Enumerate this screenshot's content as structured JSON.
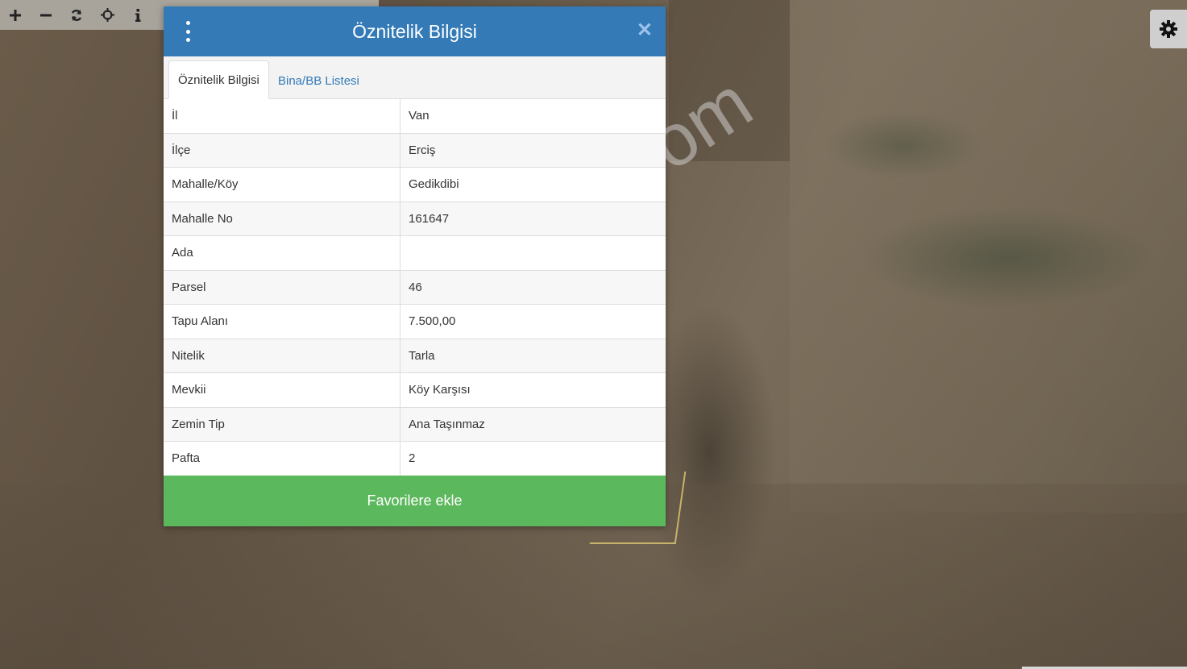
{
  "toolbar": {
    "tools": [
      {
        "icon": "zoom-in-icon"
      },
      {
        "icon": "zoom-out-icon"
      },
      {
        "icon": "refresh-icon"
      },
      {
        "icon": "locate-icon"
      },
      {
        "icon": "info-icon"
      }
    ]
  },
  "settings": {
    "icon": "gear-icon"
  },
  "watermark": "emlakjet.com",
  "dialog": {
    "title": "Öznitelik Bilgisi",
    "close_symbol": "✕",
    "tabs": [
      {
        "label": "Öznitelik Bilgisi",
        "active": true
      },
      {
        "label": "Bina/BB Listesi",
        "active": false
      }
    ],
    "rows": [
      {
        "key": "İl",
        "value": "Van"
      },
      {
        "key": "İlçe",
        "value": "Erciş"
      },
      {
        "key": "Mahalle/Köy",
        "value": "Gedikdibi"
      },
      {
        "key": "Mahalle No",
        "value": "161647"
      },
      {
        "key": "Ada",
        "value": ""
      },
      {
        "key": "Parsel",
        "value": "46"
      },
      {
        "key": "Tapu Alanı",
        "value": "7.500,00"
      },
      {
        "key": "Nitelik",
        "value": "Tarla"
      },
      {
        "key": "Mevkii",
        "value": "Köy Karşısı"
      },
      {
        "key": "Zemin Tip",
        "value": "Ana Taşınmaz"
      },
      {
        "key": "Pafta",
        "value": "2"
      }
    ],
    "favorite_button": "Favorilere ekle"
  },
  "colors": {
    "header": "#337ab7",
    "button": "#5cb85c",
    "parcel_outline": "#c9b26a"
  }
}
